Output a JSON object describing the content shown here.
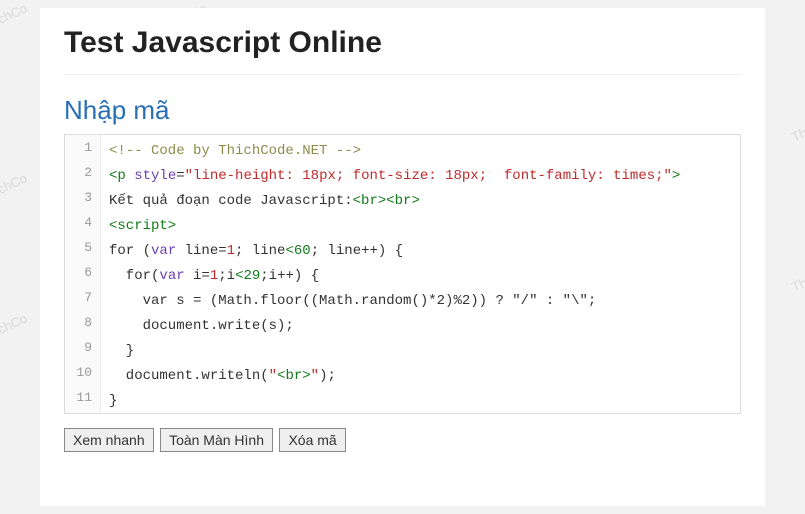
{
  "watermark": "ThichCo",
  "header": {
    "title": "Test Javascript Online"
  },
  "section": {
    "label": "Nhập mã"
  },
  "editor": {
    "lines": [
      {
        "num": "1",
        "segs": [
          {
            "t": "<!-- Code by ThichCode.NET -->",
            "c": "c-comment"
          }
        ]
      },
      {
        "num": "2",
        "segs": [
          {
            "t": "<p ",
            "c": "c-tag"
          },
          {
            "t": "style",
            "c": "c-attr"
          },
          {
            "t": "=",
            "c": ""
          },
          {
            "t": "\"line-height: 18px; font-size: 18px;  font-family: times;\"",
            "c": "c-str"
          },
          {
            "t": ">",
            "c": "c-tag"
          }
        ]
      },
      {
        "num": "3",
        "segs": [
          {
            "t": "Kết quả đoạn code Javascript:",
            "c": ""
          },
          {
            "t": "<br><br>",
            "c": "c-tag"
          }
        ]
      },
      {
        "num": "4",
        "segs": [
          {
            "t": "<script>",
            "c": "c-tag"
          }
        ]
      },
      {
        "num": "5",
        "segs": [
          {
            "t": "for ",
            "c": ""
          },
          {
            "t": "(",
            "c": ""
          },
          {
            "t": "var ",
            "c": "c-kw"
          },
          {
            "t": "line=",
            "c": ""
          },
          {
            "t": "1",
            "c": "c-num"
          },
          {
            "t": "; line",
            "c": ""
          },
          {
            "t": "<60",
            "c": "c-tag"
          },
          {
            "t": "; line++) {",
            "c": ""
          }
        ]
      },
      {
        "num": "6",
        "segs": [
          {
            "t": "  for(",
            "c": ""
          },
          {
            "t": "var ",
            "c": "c-kw"
          },
          {
            "t": "i=",
            "c": ""
          },
          {
            "t": "1",
            "c": "c-num"
          },
          {
            "t": ";i",
            "c": ""
          },
          {
            "t": "<29",
            "c": "c-tag"
          },
          {
            "t": ";i++) {",
            "c": ""
          }
        ]
      },
      {
        "num": "7",
        "segs": [
          {
            "t": "    var s = (Math.floor((Math.random()*2)%2)) ? \"/\" : \"\\\";",
            "c": ""
          }
        ]
      },
      {
        "num": "8",
        "segs": [
          {
            "t": "    document.write(s);",
            "c": ""
          }
        ]
      },
      {
        "num": "9",
        "segs": [
          {
            "t": "  }",
            "c": ""
          }
        ]
      },
      {
        "num": "10",
        "segs": [
          {
            "t": "  document.writeln(",
            "c": ""
          },
          {
            "t": "\"",
            "c": "c-str"
          },
          {
            "t": "<br>",
            "c": "c-tag"
          },
          {
            "t": "\"",
            "c": "c-str"
          },
          {
            "t": ");",
            "c": ""
          }
        ]
      },
      {
        "num": "11",
        "segs": [
          {
            "t": "}",
            "c": ""
          }
        ]
      }
    ]
  },
  "buttons": {
    "preview": "Xem nhanh",
    "fullscreen": "Toàn Màn Hình",
    "clear": "Xóa mã"
  }
}
